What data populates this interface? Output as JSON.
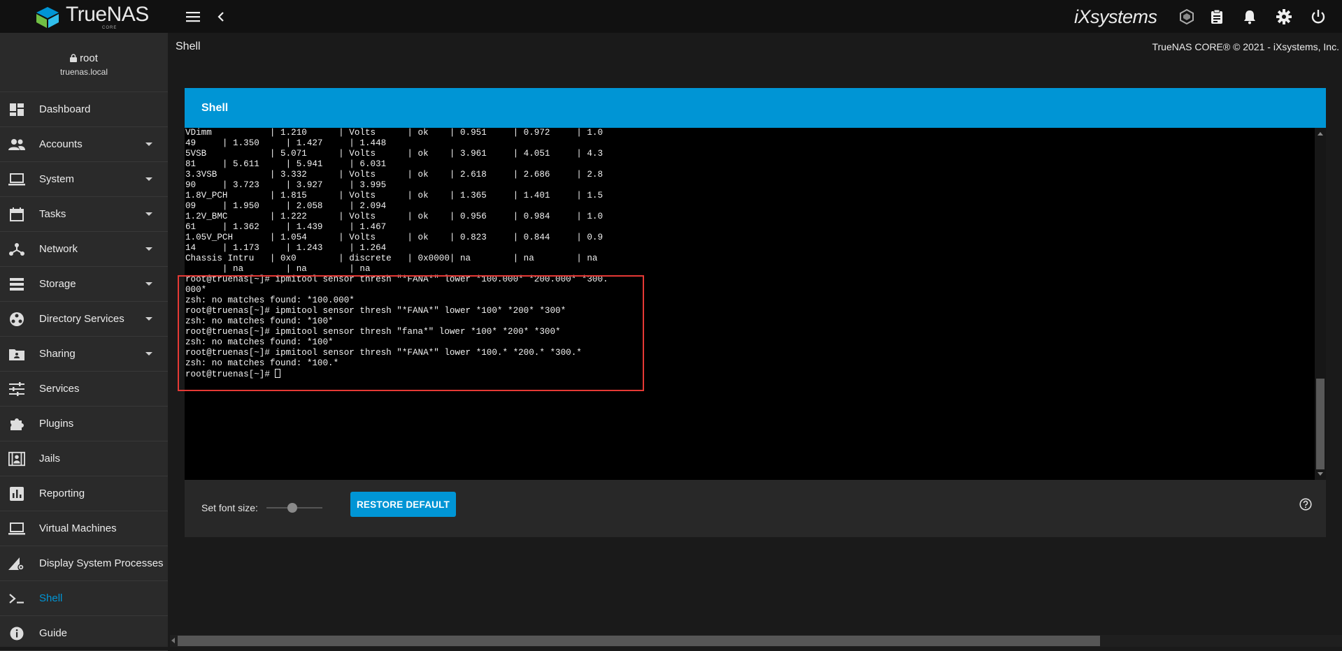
{
  "topbar": {
    "brand": "TrueNAS",
    "brand_sub": "CORE",
    "vendor_logo": "iXsystems",
    "icons": [
      "menu-icon",
      "back-icon",
      "truecommand-icon",
      "clipboard-icon",
      "bell-icon",
      "gear-icon",
      "power-icon"
    ]
  },
  "user": {
    "name": "root",
    "host": "truenas.local"
  },
  "sidebar": {
    "items": [
      {
        "label": "Dashboard",
        "icon": "dashboard-icon",
        "expandable": false
      },
      {
        "label": "Accounts",
        "icon": "people-icon",
        "expandable": true
      },
      {
        "label": "System",
        "icon": "laptop-icon",
        "expandable": true
      },
      {
        "label": "Tasks",
        "icon": "calendar-icon",
        "expandable": true
      },
      {
        "label": "Network",
        "icon": "network-icon",
        "expandable": true
      },
      {
        "label": "Storage",
        "icon": "storage-icon",
        "expandable": true
      },
      {
        "label": "Directory Services",
        "icon": "directory-icon",
        "expandable": true
      },
      {
        "label": "Sharing",
        "icon": "folder-shared-icon",
        "expandable": true
      },
      {
        "label": "Services",
        "icon": "tune-icon",
        "expandable": false
      },
      {
        "label": "Plugins",
        "icon": "puzzle-icon",
        "expandable": false
      },
      {
        "label": "Jails",
        "icon": "jail-icon",
        "expandable": false
      },
      {
        "label": "Reporting",
        "icon": "chart-icon",
        "expandable": false
      },
      {
        "label": "Virtual Machines",
        "icon": "laptop-icon",
        "expandable": false
      },
      {
        "label": "Display System Processes",
        "icon": "processes-icon",
        "expandable": false
      },
      {
        "label": "Shell",
        "icon": "terminal-icon",
        "expandable": false,
        "active": true
      },
      {
        "label": "Guide",
        "icon": "info-icon",
        "expandable": false
      }
    ]
  },
  "page": {
    "title": "Shell",
    "copyright": "TrueNAS CORE® © 2021 - iXsystems, Inc."
  },
  "shell_card": {
    "title": "Shell",
    "terminal_lines": [
      "VDimm           | 1.210      | Volts      | ok    | 0.951     | 0.972     | 1.0",
      "49     | 1.350     | 1.427     | 1.448",
      "5VSB            | 5.071      | Volts      | ok    | 3.961     | 4.051     | 4.3",
      "81     | 5.611     | 5.941     | 6.031",
      "3.3VSB          | 3.332      | Volts      | ok    | 2.618     | 2.686     | 2.8",
      "90     | 3.723     | 3.927     | 3.995",
      "1.8V_PCH        | 1.815      | Volts      | ok    | 1.365     | 1.401     | 1.5",
      "09     | 1.950     | 2.058     | 2.094",
      "1.2V_BMC        | 1.222      | Volts      | ok    | 0.956     | 0.984     | 1.0",
      "61     | 1.362     | 1.439     | 1.467",
      "1.05V_PCH       | 1.054      | Volts      | ok    | 0.823     | 0.844     | 0.9",
      "14     | 1.173     | 1.243     | 1.264",
      "Chassis Intru   | 0x0        | discrete   | 0x0000| na        | na        | na",
      "       | na        | na        | na",
      "root@truenas[~]# ipmitool sensor thresh \"*FANA*\" lower *100.000* *200.000* *300.",
      "000*",
      "zsh: no matches found: *100.000*",
      "root@truenas[~]# ipmitool sensor thresh \"*FANA*\" lower *100* *200* *300*",
      "zsh: no matches found: *100*",
      "root@truenas[~]# ipmitool sensor thresh \"fana*\" lower *100* *200* *300*",
      "zsh: no matches found: *100*",
      "root@truenas[~]# ipmitool sensor thresh \"*FANA*\" lower *100.* *200.* *300.*",
      "zsh: no matches found: *100.*"
    ],
    "prompt": "root@truenas[~]# ",
    "font_size_label": "Set font size:",
    "font_size_value": 0.45,
    "restore_label": "RESTORE DEFAULT",
    "help_icon": "help-icon"
  },
  "colors": {
    "accent": "#0095d5",
    "highlight_box": "#e53935",
    "terminal_bg": "#000000",
    "sidebar_bg": "#2a2a2a",
    "topbar_bg": "#111111"
  }
}
